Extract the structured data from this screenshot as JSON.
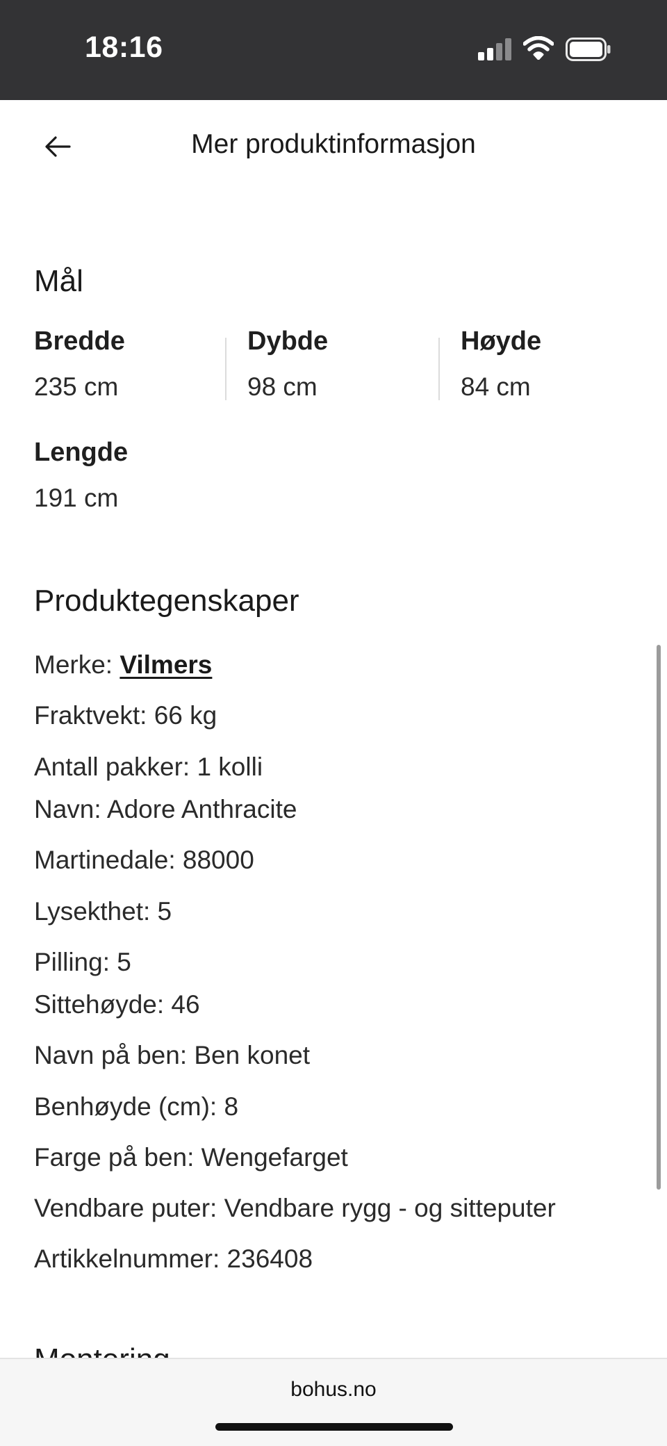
{
  "status_bar": {
    "time": "18:16",
    "icons": [
      "cellular-signal-icon",
      "wifi-icon",
      "battery-icon"
    ],
    "background": "#333335"
  },
  "header": {
    "back_icon": "arrow-left-icon",
    "title": "Mer produktinformasjon"
  },
  "dimensions": {
    "title": "Mål",
    "items": [
      {
        "label": "Bredde",
        "value": "235 cm"
      },
      {
        "label": "Dybde",
        "value": "98 cm"
      },
      {
        "label": "Høyde",
        "value": "84 cm"
      },
      {
        "label": "Lengde",
        "value": "191 cm"
      }
    ]
  },
  "properties": {
    "title": "Produktegenskaper",
    "brand_label": "Merke:",
    "brand_link": "Vilmers",
    "items": [
      "Fraktvekt: 66 kg",
      "Antall pakker: 1 kolli",
      "Navn: Adore Anthracite",
      "Martinedale: 88000",
      "Lysekthet: 5",
      "Pilling: 5",
      "Sittehøyde: 46",
      "Navn på ben: Ben konet",
      "Benhøyde (cm): 8",
      "Farge på ben: Wengefarget",
      "Vendbare puter: Vendbare rygg - og sitteputer",
      "Artikkelnummer: 236408"
    ]
  },
  "next_section": {
    "title": "Montering"
  },
  "browser": {
    "url": "bohus.no"
  }
}
